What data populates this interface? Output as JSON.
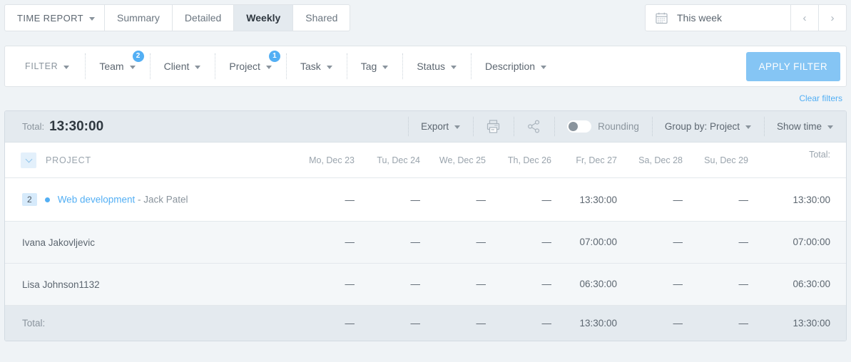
{
  "tabs": [
    {
      "label": "TIME REPORT",
      "type": "dropdown",
      "active": false
    },
    {
      "label": "Summary",
      "type": "tab",
      "active": false
    },
    {
      "label": "Detailed",
      "type": "tab",
      "active": false
    },
    {
      "label": "Weekly",
      "type": "tab",
      "active": true
    },
    {
      "label": "Shared",
      "type": "tab",
      "active": false
    }
  ],
  "datepicker": {
    "value": "This week",
    "prev": "‹",
    "next": "›",
    "icon": "calendar-icon"
  },
  "filter": {
    "label": "FILTER",
    "items": [
      {
        "label": "Team",
        "badge": "2"
      },
      {
        "label": "Client",
        "badge": null
      },
      {
        "label": "Project",
        "badge": "1"
      },
      {
        "label": "Task",
        "badge": null
      },
      {
        "label": "Tag",
        "badge": null
      },
      {
        "label": "Status",
        "badge": null
      },
      {
        "label": "Description",
        "badge": null
      }
    ],
    "apply_label": "APPLY FILTER",
    "clear_label": "Clear filters",
    "accent": "#53aff4",
    "apply_bg": "#85c5f4"
  },
  "toolbar": {
    "total_label": "Total:",
    "total_value": "13:30:00",
    "export_label": "Export",
    "print_icon": "printer-icon",
    "share_icon": "share-icon",
    "rounding_label": "Rounding",
    "rounding_on": false,
    "group_by_label": "Group by: Project",
    "show_time_label": "Show time"
  },
  "table": {
    "group_header": "PROJECT",
    "total_header": "Total:",
    "days": [
      "Mo, Dec 23",
      "Tu, Dec 24",
      "We, Dec 25",
      "Th, Dec 26",
      "Fr, Dec 27",
      "Sa, Dec 28",
      "Su, Dec 29"
    ],
    "rows": [
      {
        "count": "2",
        "dot": true,
        "project": "Web development",
        "owner": " - Jack Patel",
        "values": [
          "—",
          "—",
          "—",
          "—",
          "13:30:00",
          "—",
          "—"
        ],
        "total": "13:30:00"
      },
      {
        "count": null,
        "dot": false,
        "project": null,
        "name": "Ivana Jakovljevic",
        "owner": "",
        "values": [
          "—",
          "—",
          "—",
          "—",
          "07:00:00",
          "—",
          "—"
        ],
        "total": "07:00:00"
      },
      {
        "count": null,
        "dot": false,
        "project": null,
        "name": "Lisa Johnson1132",
        "owner": "",
        "values": [
          "—",
          "—",
          "—",
          "—",
          "06:30:00",
          "—",
          "—"
        ],
        "total": "06:30:00"
      }
    ],
    "footer": {
      "label": "Total:",
      "values": [
        "—",
        "—",
        "—",
        "—",
        "13:30:00",
        "—",
        "—"
      ],
      "total": "13:30:00"
    }
  }
}
